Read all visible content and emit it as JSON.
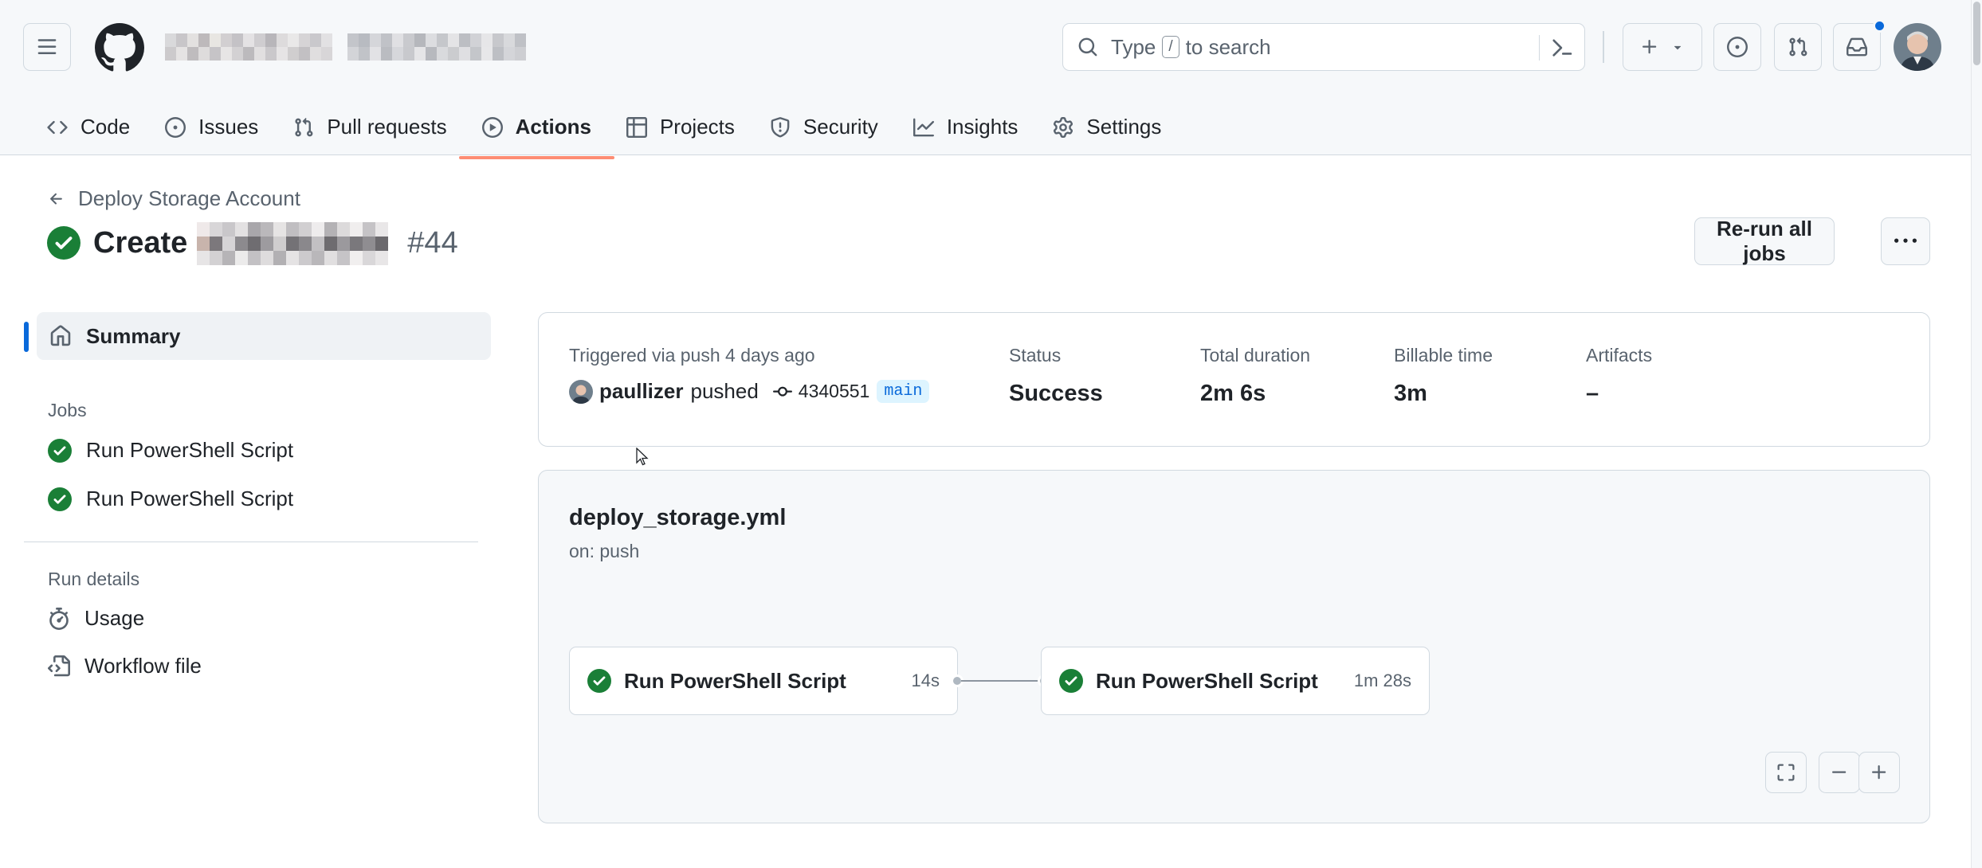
{
  "header": {
    "search_prefix": "Type",
    "search_slash": "/",
    "search_suffix": "to search",
    "icons": [
      "hamburger-icon",
      "github-logo-icon",
      "search-icon",
      "command-palette-icon",
      "plus-icon",
      "chevron-down-icon",
      "issue-opened-icon",
      "git-pull-request-icon",
      "inbox-icon",
      "avatar"
    ],
    "notification_dot_color": "#0969da"
  },
  "repo_nav": {
    "tabs": [
      {
        "label": "Code",
        "icon": "code-icon",
        "active": false
      },
      {
        "label": "Issues",
        "icon": "issue-opened-icon",
        "active": false
      },
      {
        "label": "Pull requests",
        "icon": "git-pull-request-icon",
        "active": false
      },
      {
        "label": "Actions",
        "icon": "play-icon",
        "active": true
      },
      {
        "label": "Projects",
        "icon": "table-icon",
        "active": false
      },
      {
        "label": "Security",
        "icon": "shield-icon",
        "active": false
      },
      {
        "label": "Insights",
        "icon": "graph-icon",
        "active": false
      },
      {
        "label": "Settings",
        "icon": "gear-icon",
        "active": false
      }
    ],
    "active_underline_color": "#fd8c73"
  },
  "run": {
    "back_label": "Deploy Storage Account",
    "title_prefix": "Create",
    "run_number": "#44",
    "rerun_label": "Re-run all jobs",
    "status_color": "#1a7f37"
  },
  "sidebar": {
    "summary_label": "Summary",
    "jobs_heading": "Jobs",
    "jobs": [
      {
        "label": "Run PowerShell Script",
        "status": "success"
      },
      {
        "label": "Run PowerShell Script",
        "status": "success"
      }
    ],
    "run_details_heading": "Run details",
    "details": [
      {
        "label": "Usage",
        "icon": "stopwatch-icon"
      },
      {
        "label": "Workflow file",
        "icon": "file-code-icon"
      }
    ],
    "active_color": "#0969da"
  },
  "summary": {
    "trigger_label": "Triggered via push 4 days ago",
    "actor": "paullizer",
    "action": "pushed",
    "commit": "4340551",
    "branch": "main",
    "status_label": "Status",
    "status_value": "Success",
    "duration_label": "Total duration",
    "duration_value": "2m 6s",
    "billable_label": "Billable time",
    "billable_value": "3m",
    "artifacts_label": "Artifacts",
    "artifacts_value": "–"
  },
  "workflow": {
    "file": "deploy_storage.yml",
    "trigger": "on: push",
    "jobs": [
      {
        "label": "Run PowerShell Script",
        "duration": "14s"
      },
      {
        "label": "Run PowerShell Script",
        "duration": "1m 28s"
      }
    ],
    "controls": [
      "fullscreen-icon",
      "zoom-out-icon",
      "zoom-in-icon"
    ]
  }
}
